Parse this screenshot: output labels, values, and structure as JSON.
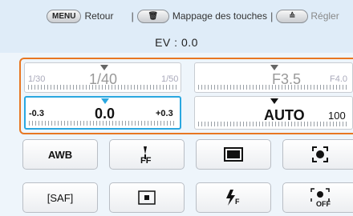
{
  "topbar": {
    "menu_key": "MENU",
    "menu_label": "Retour",
    "trash_key": "🗑",
    "trash_label": "Mappage des touches",
    "dial_key": "≙",
    "dial_label": "Régler"
  },
  "ev_header": "EV : 0.0",
  "shutter": {
    "min": "1/30",
    "value": "1/40",
    "max": "1/50"
  },
  "aperture": {
    "value": "F3.5",
    "max": "F4.0"
  },
  "ev": {
    "min": "-0.3",
    "value": "0.0",
    "max": "+0.3"
  },
  "iso": {
    "value": "AUTO",
    "max": "100"
  },
  "grid": {
    "row1": [
      "AWB",
      "WB fine-tune",
      "Metering",
      "Face detect"
    ],
    "row2": [
      "[SAF]",
      "Focus area",
      "Flash",
      "Smart filter"
    ],
    "awb_label": "AWB",
    "saf_label": "[SAF]"
  },
  "colors": {
    "group_border": "#e87722",
    "ev_highlight": "#2aa7e0"
  }
}
